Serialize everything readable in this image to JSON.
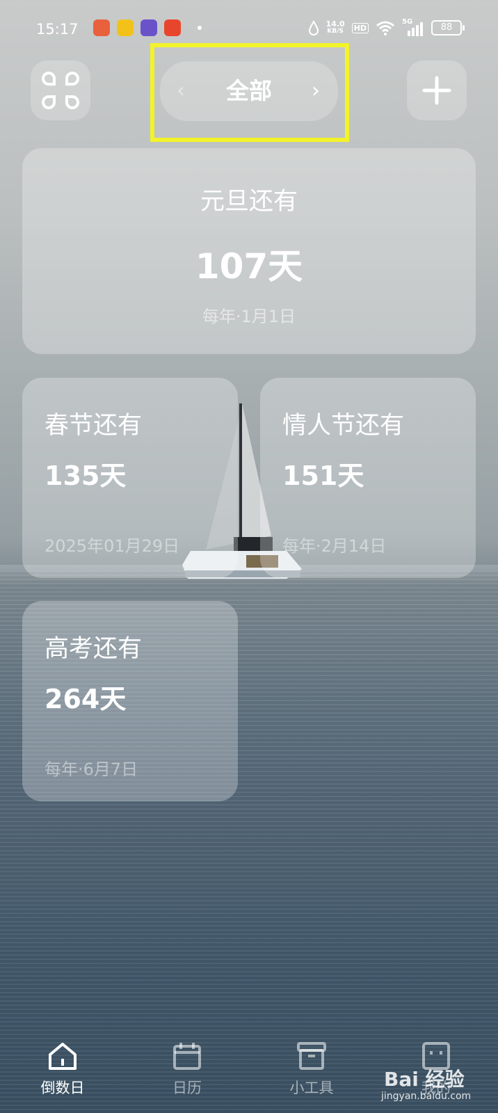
{
  "status_bar": {
    "time": "15:17",
    "net_speed_value": "14.0",
    "net_speed_unit": "KB/S",
    "hd": "HD",
    "signal": "5G",
    "battery": "88"
  },
  "header": {
    "title": "全部"
  },
  "cards": {
    "new_year": {
      "title": "元旦还有",
      "days": "107天",
      "date": "每年·1月1日"
    },
    "spring": {
      "title": "春节还有",
      "days": "135天",
      "date": "2025年01月29日"
    },
    "valentine": {
      "title": "情人节还有",
      "days": "151天",
      "date": "每年·2月14日"
    },
    "exam": {
      "title": "高考还有",
      "days": "264天",
      "date": "每年·6月7日"
    }
  },
  "bottom_nav": {
    "home": "倒数日",
    "calendar": "日历",
    "tools": "小工具",
    "me": "我的"
  },
  "watermark": {
    "main": "Bai 经验",
    "sub": "jingyan.baidu.com"
  },
  "colors": {
    "highlight": "#f3f32a"
  }
}
